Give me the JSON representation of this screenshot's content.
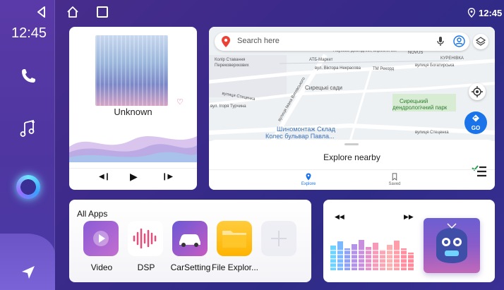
{
  "status": {
    "time": "12:45"
  },
  "sidebar": {
    "time": "12:45"
  },
  "music": {
    "title": "Unknown"
  },
  "map": {
    "search_placeholder": "Search here",
    "labels": {
      "atb": "АТБ-Маркет",
      "institute": "Науково-дослідний, виробничий",
      "nova": "NOVUS",
      "kurenivka": "КУРЕНІВКА",
      "avg": "Колір Ставання",
      "perekop": "Перековерхкових",
      "nekrasova": "вул. Віктора Некрасова",
      "tm": "ТМ Рекорд",
      "bogatyrska": "вулиця Богатирська",
      "syretsky_sad": "Сирецькі сади",
      "stetsenka": "вулиця Стеценка",
      "turchyna": "вул. Ігоря Турчина",
      "vasylkivska": "вулиця Івана Виговського",
      "park_1": "Сирецький",
      "park_2": "дендрологічний парк",
      "shino_1": "Шиномонтаж Склад",
      "shino_2": "Колес бульвар Павла...",
      "stetsenka_2": "вулиця Стеценка"
    },
    "go_label": "GO",
    "explore_title": "Explore nearby",
    "tabs": {
      "explore": "Explore",
      "saved": "Saved"
    }
  },
  "apps": {
    "title": "All Apps",
    "items": [
      {
        "label": "Video"
      },
      {
        "label": "DSP"
      },
      {
        "label": "CarSetting"
      },
      {
        "label": "File Explor..."
      }
    ]
  },
  "colors": {
    "background": "#3b2a8a",
    "accent_blue": "#1a73e8",
    "heart": "#e14b6a"
  },
  "icons": {
    "sidebar": [
      "back-icon",
      "phone-icon",
      "music-note-icon",
      "assistant-icon",
      "navigation-icon"
    ],
    "topbar": [
      "home-icon",
      "recents-icon",
      "location-icon"
    ]
  }
}
